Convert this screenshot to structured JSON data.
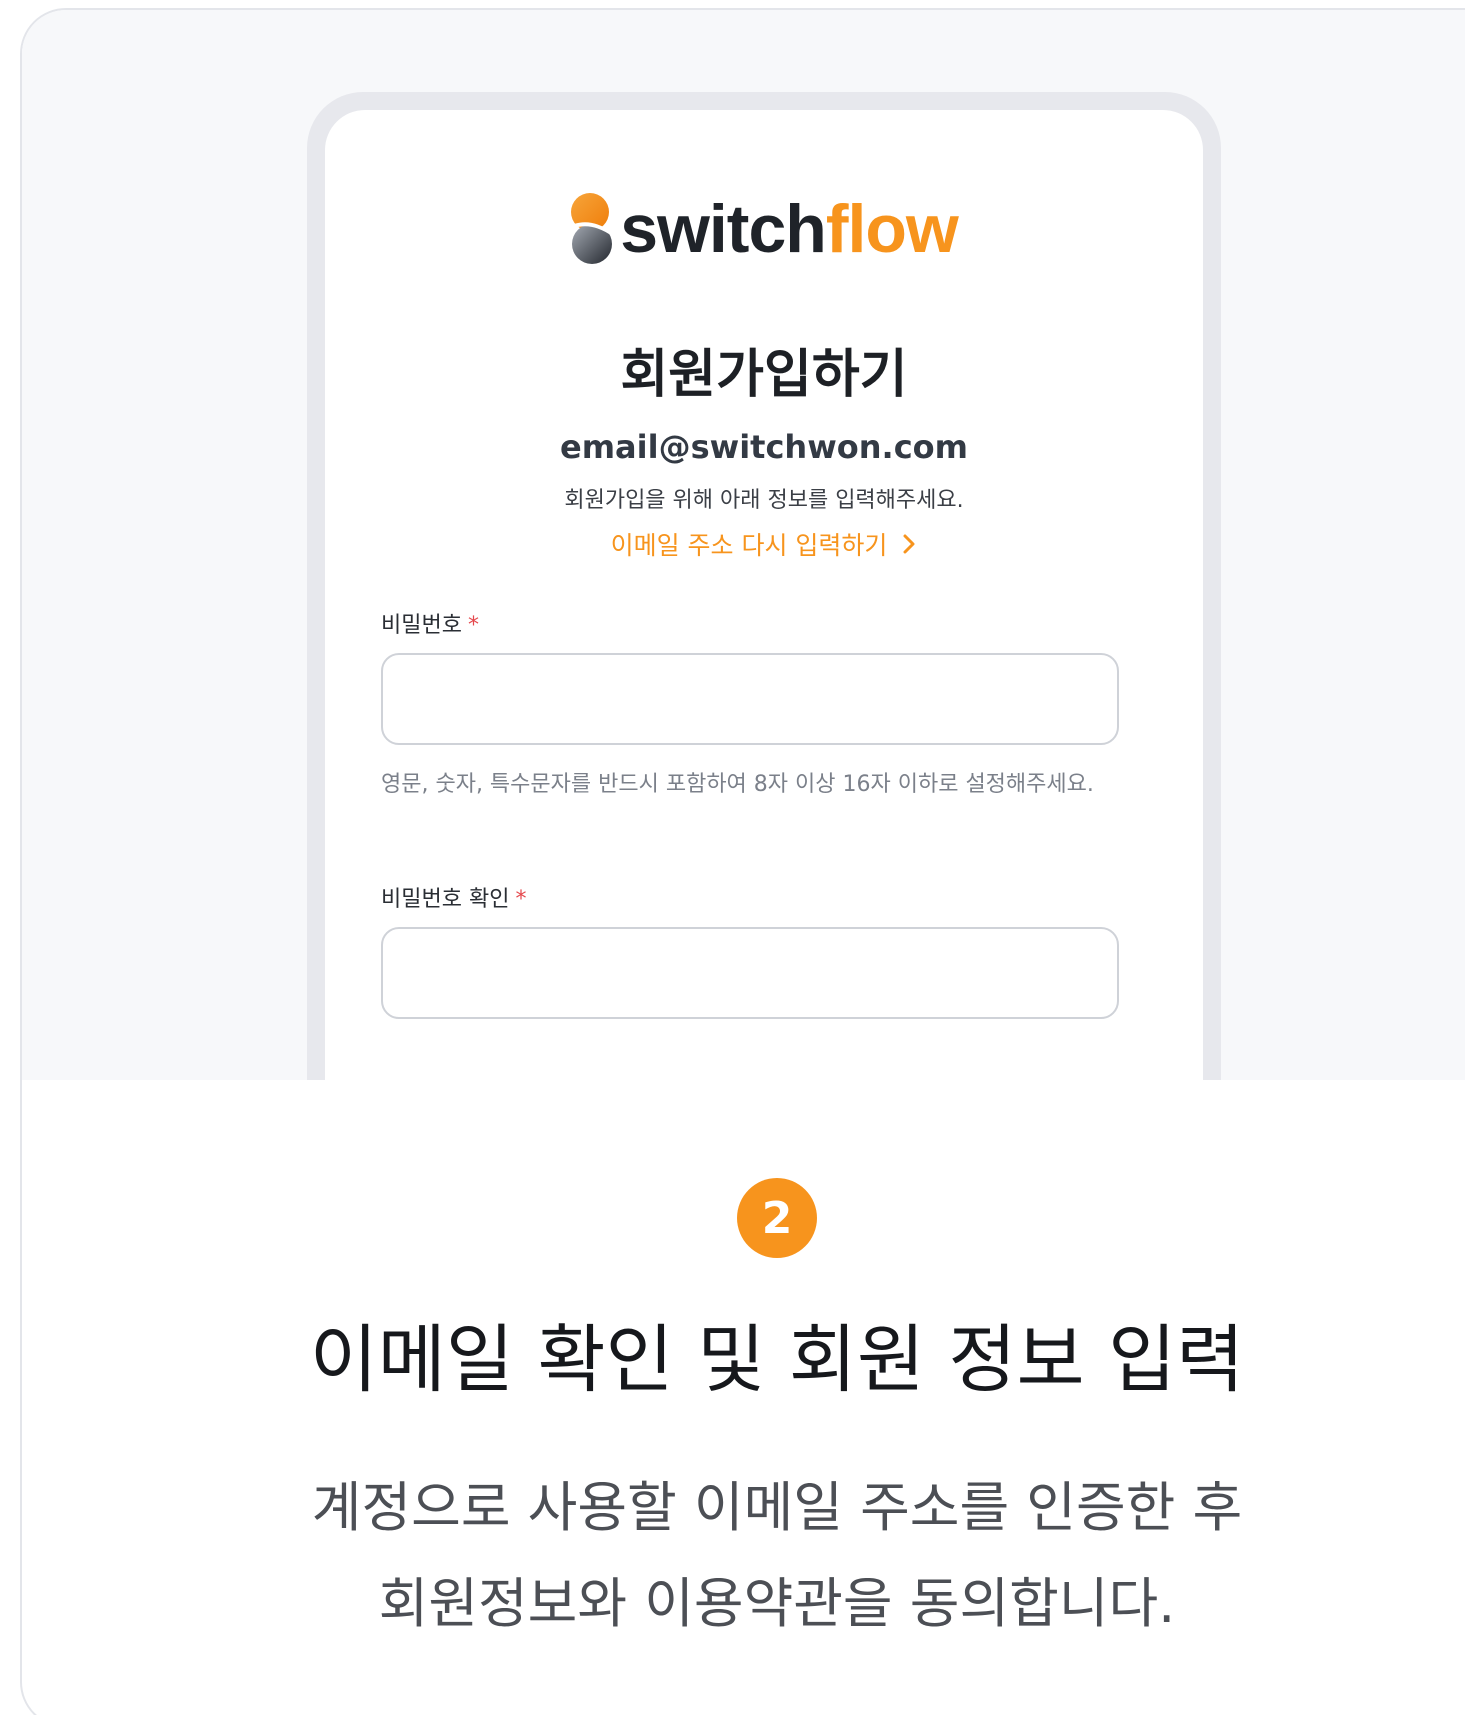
{
  "logo": {
    "part1": "switch",
    "part2": "flow"
  },
  "signup": {
    "title": "회원가입하기",
    "email": "email@switchwon.com",
    "description": "회원가입을 위해 아래 정보를 입력해주세요.",
    "reenter_link": "이메일 주소 다시 입력하기"
  },
  "fields": {
    "password": {
      "label": "비밀번호",
      "required_mark": "*",
      "value": "",
      "help": "영문, 숫자, 특수문자를 반드시 포함하여 8자 이상 16자 이하로 설정해주세요."
    },
    "password_confirm": {
      "label": "비밀번호 확인",
      "required_mark": "*",
      "value": ""
    }
  },
  "step": {
    "number": "2",
    "title": "이메일 확인 및 회원 정보 입력",
    "description_line1": "계정으로 사용할 이메일 주소를 인증한 후",
    "description_line2": "회원정보와 이용약관을 동의합니다."
  },
  "colors": {
    "accent": "#f7941d",
    "required": "#e5484d",
    "dark": "#1f2329"
  },
  "icons": {
    "logo": "switchflow-logo-mark",
    "link_arrow": "chevron-right-icon"
  }
}
